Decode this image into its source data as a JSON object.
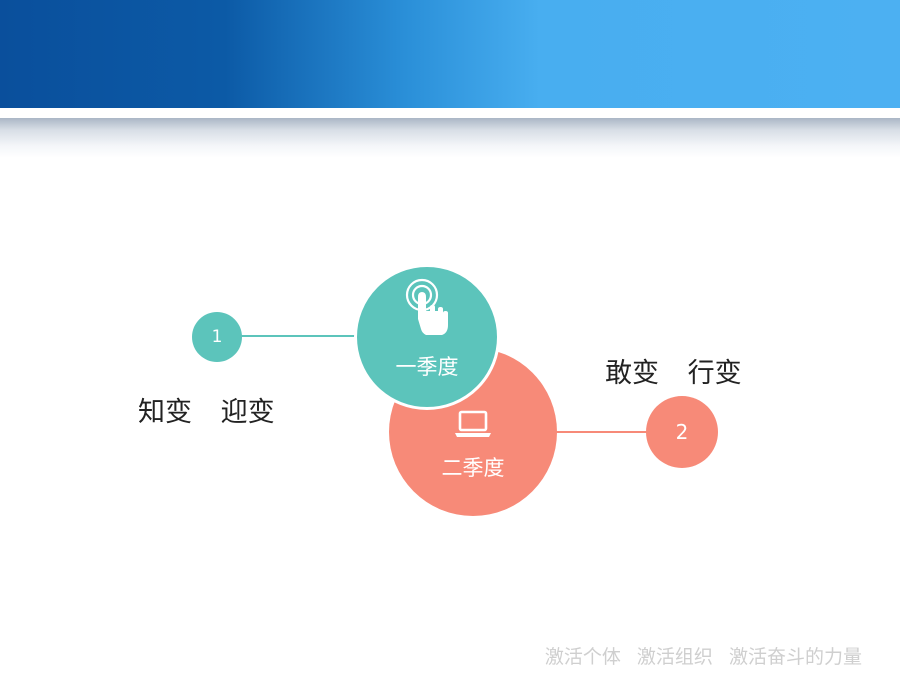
{
  "colors": {
    "teal": "#5cc4bb",
    "coral": "#f78a78",
    "header_dark": "#0c5aa6",
    "header_light": "#4cb0f2"
  },
  "stage1": {
    "number": "1",
    "label": "一季度",
    "icon": "hand-pointer-icon",
    "captions": [
      "知变",
      "迎变"
    ]
  },
  "stage2": {
    "number": "2",
    "label": "二季度",
    "icon": "laptop-icon",
    "captions": [
      "敢变",
      "行变"
    ]
  },
  "footer": {
    "items": [
      "激活个体",
      "激活组织",
      "激活奋斗的力量"
    ]
  }
}
